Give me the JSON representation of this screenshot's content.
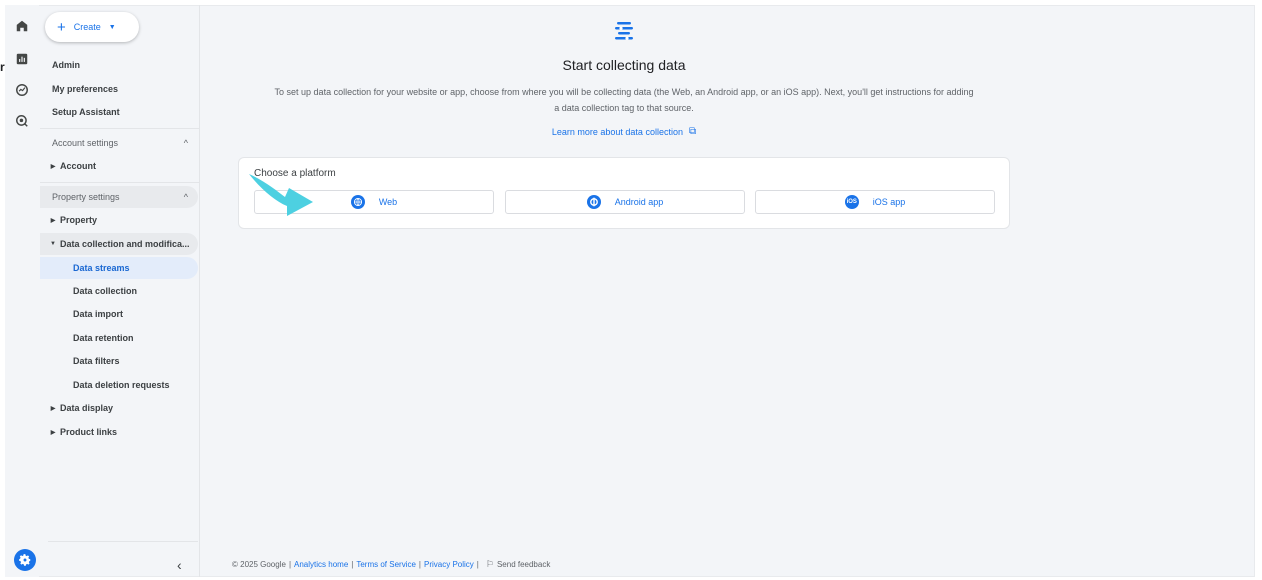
{
  "rail": {
    "stray_char": "r",
    "icons": [
      "home-icon",
      "reports-icon",
      "explore-icon",
      "advertising-icon"
    ],
    "settings_icon": "gear-icon"
  },
  "nav": {
    "create_label": "Create",
    "items": [
      "Admin",
      "My preferences",
      "Setup Assistant"
    ],
    "account_settings": {
      "label": "Account settings",
      "children": [
        "Account"
      ]
    },
    "property_settings": {
      "label": "Property settings",
      "property": "Property",
      "data_collection": {
        "label": "Data collection and modifica...",
        "children": [
          "Data streams",
          "Data collection",
          "Data import",
          "Data retention",
          "Data filters",
          "Data deletion requests"
        ],
        "active": "Data streams"
      },
      "data_display": "Data display",
      "product_links": "Product links"
    },
    "collapse_glyph": "‹"
  },
  "main": {
    "title": "Start collecting data",
    "description": "To set up data collection for your website or app, choose from where you will be collecting data (the Web, an Android app, or an iOS app). Next, you'll get instructions for adding a data collection tag to that source.",
    "learn_more": "Learn more about data collection",
    "card": {
      "label": "Choose a platform",
      "platforms": [
        {
          "label": "Web",
          "icon": "globe-icon"
        },
        {
          "label": "Android app",
          "icon": "android-icon"
        },
        {
          "label": "iOS app",
          "icon": "ios-icon",
          "badge": "iOS"
        }
      ]
    },
    "accent_color": "#1a73e8",
    "arrow_color": "#4dd0e1"
  },
  "footer": {
    "copyright": "© 2025 Google",
    "links": [
      "Analytics home",
      "Terms of Service",
      "Privacy Policy"
    ],
    "feedback": "Send feedback",
    "separator": "|"
  }
}
